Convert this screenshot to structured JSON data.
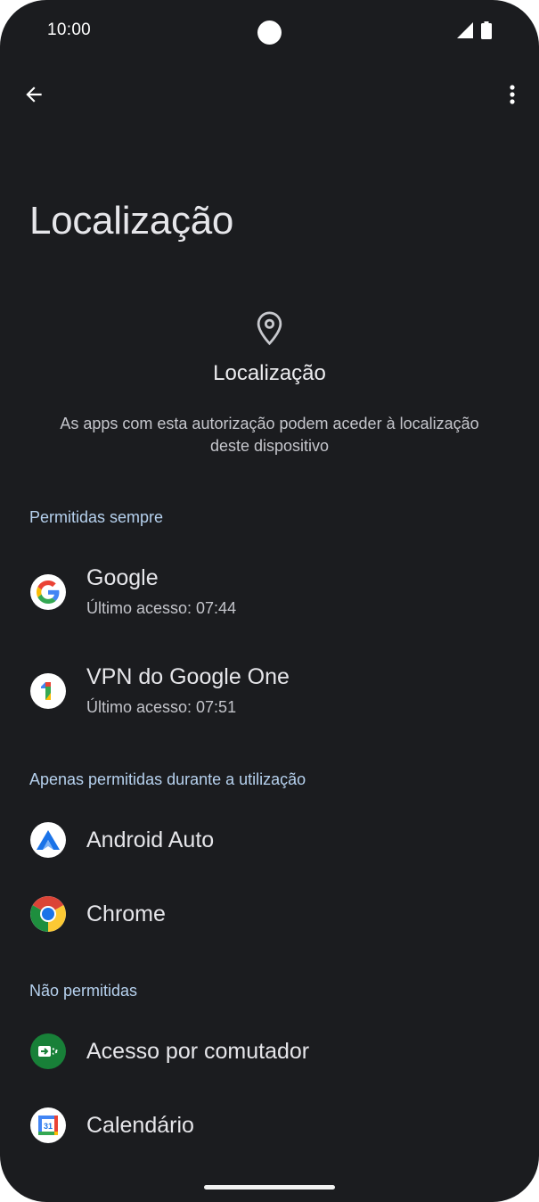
{
  "status_bar": {
    "time": "10:00"
  },
  "toolbar": {
    "back_icon": "arrow-back-icon",
    "more_icon": "more-vert-icon"
  },
  "page": {
    "title": "Localização"
  },
  "header": {
    "icon": "location-pin-icon",
    "title": "Localização",
    "description": "As apps com esta autorização podem aceder à localização deste dispositivo"
  },
  "sections": [
    {
      "label": "Permitidas sempre",
      "apps": [
        {
          "name": "Google",
          "subtitle": "Último acesso: 07:44",
          "icon": "google-icon"
        },
        {
          "name": "VPN do Google One",
          "subtitle": "Último acesso: 07:51",
          "icon": "google-one-icon"
        }
      ]
    },
    {
      "label": "Apenas permitidas durante a utilização",
      "apps": [
        {
          "name": "Android Auto",
          "icon": "android-auto-icon"
        },
        {
          "name": "Chrome",
          "icon": "chrome-icon"
        }
      ]
    },
    {
      "label": "Não permitidas",
      "apps": [
        {
          "name": "Acesso por comutador",
          "icon": "switch-access-icon"
        },
        {
          "name": "Calendário",
          "icon": "calendar-icon",
          "icon_text": "31"
        }
      ]
    }
  ]
}
